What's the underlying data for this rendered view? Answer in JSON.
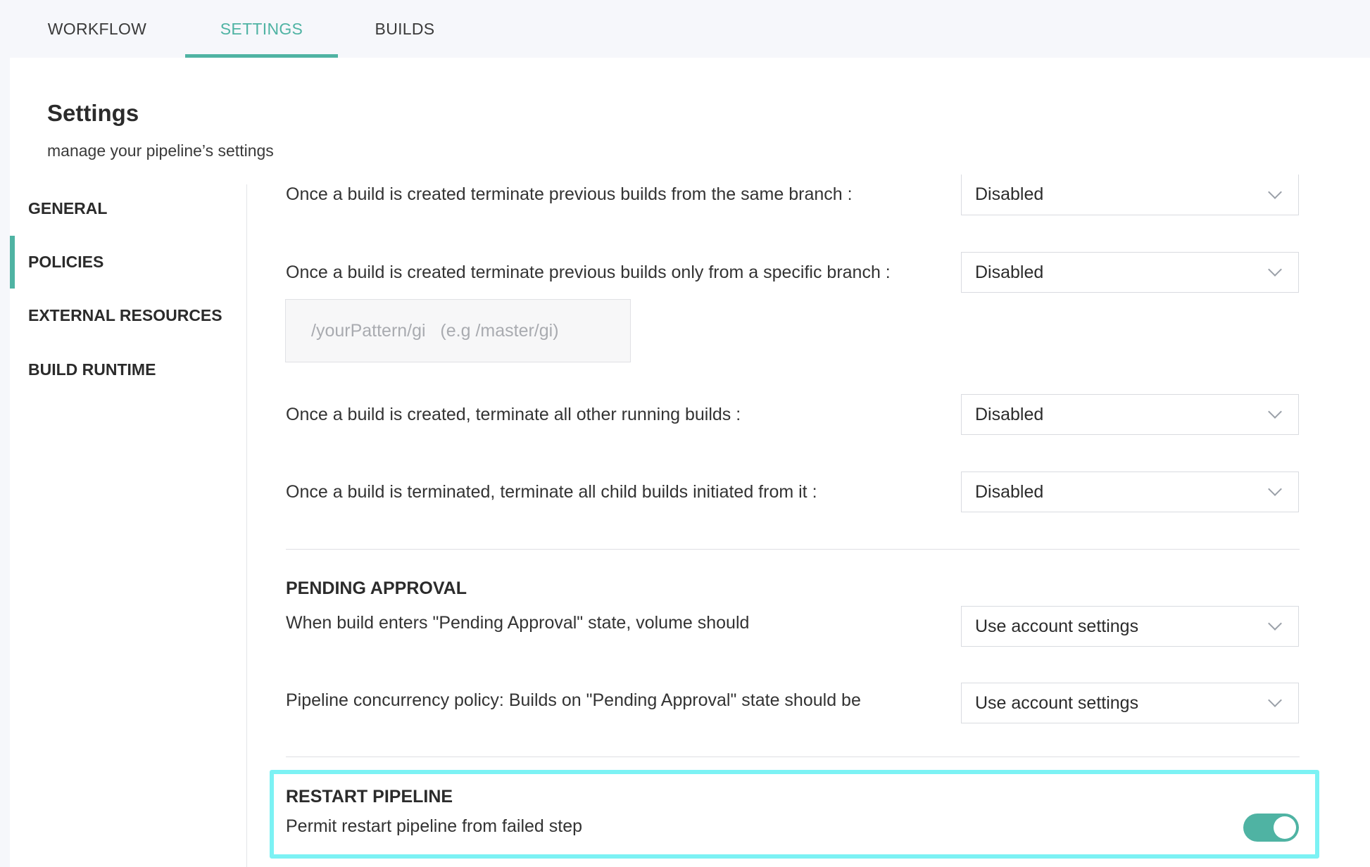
{
  "top_tabs": [
    {
      "label": "WORKFLOW",
      "active": false
    },
    {
      "label": "SETTINGS",
      "active": true
    },
    {
      "label": "BUILDS",
      "active": false
    }
  ],
  "header": {
    "title": "Settings",
    "subtitle": "manage your pipeline’s settings"
  },
  "sidebar": {
    "items": [
      {
        "label": "GENERAL",
        "active": false
      },
      {
        "label": "POLICIES",
        "active": true
      },
      {
        "label": "EXTERNAL RESOURCES",
        "active": false
      },
      {
        "label": "BUILD RUNTIME",
        "active": false
      }
    ]
  },
  "policies": {
    "terminate_same_branch": {
      "label": "Once a build is created terminate previous builds from the same branch :",
      "value": "Disabled"
    },
    "terminate_specific_branch": {
      "label": "Once a build is created terminate previous builds only from a specific branch :",
      "value": "Disabled",
      "pattern_placeholder": "/yourPattern/gi   (e.g /master/gi)"
    },
    "terminate_all_running": {
      "label": "Once a build is created, terminate all other running builds :",
      "value": "Disabled"
    },
    "terminate_child_builds": {
      "label": "Once a build is terminated, terminate all child builds initiated from it :",
      "value": "Disabled"
    }
  },
  "pending_approval": {
    "title": "PENDING APPROVAL",
    "volume": {
      "label": "When build enters \"Pending Approval\" state, volume should",
      "value": "Use account settings"
    },
    "concurrency": {
      "label": "Pipeline concurrency policy: Builds on \"Pending Approval\" state should be",
      "value": "Use account settings"
    }
  },
  "restart_pipeline": {
    "title": "RESTART PIPELINE",
    "label": "Permit restart pipeline from failed step",
    "enabled": true
  },
  "colors": {
    "accent": "#4fb3a3",
    "highlight": "#7cf2f4",
    "background": "#f6f7fb"
  }
}
